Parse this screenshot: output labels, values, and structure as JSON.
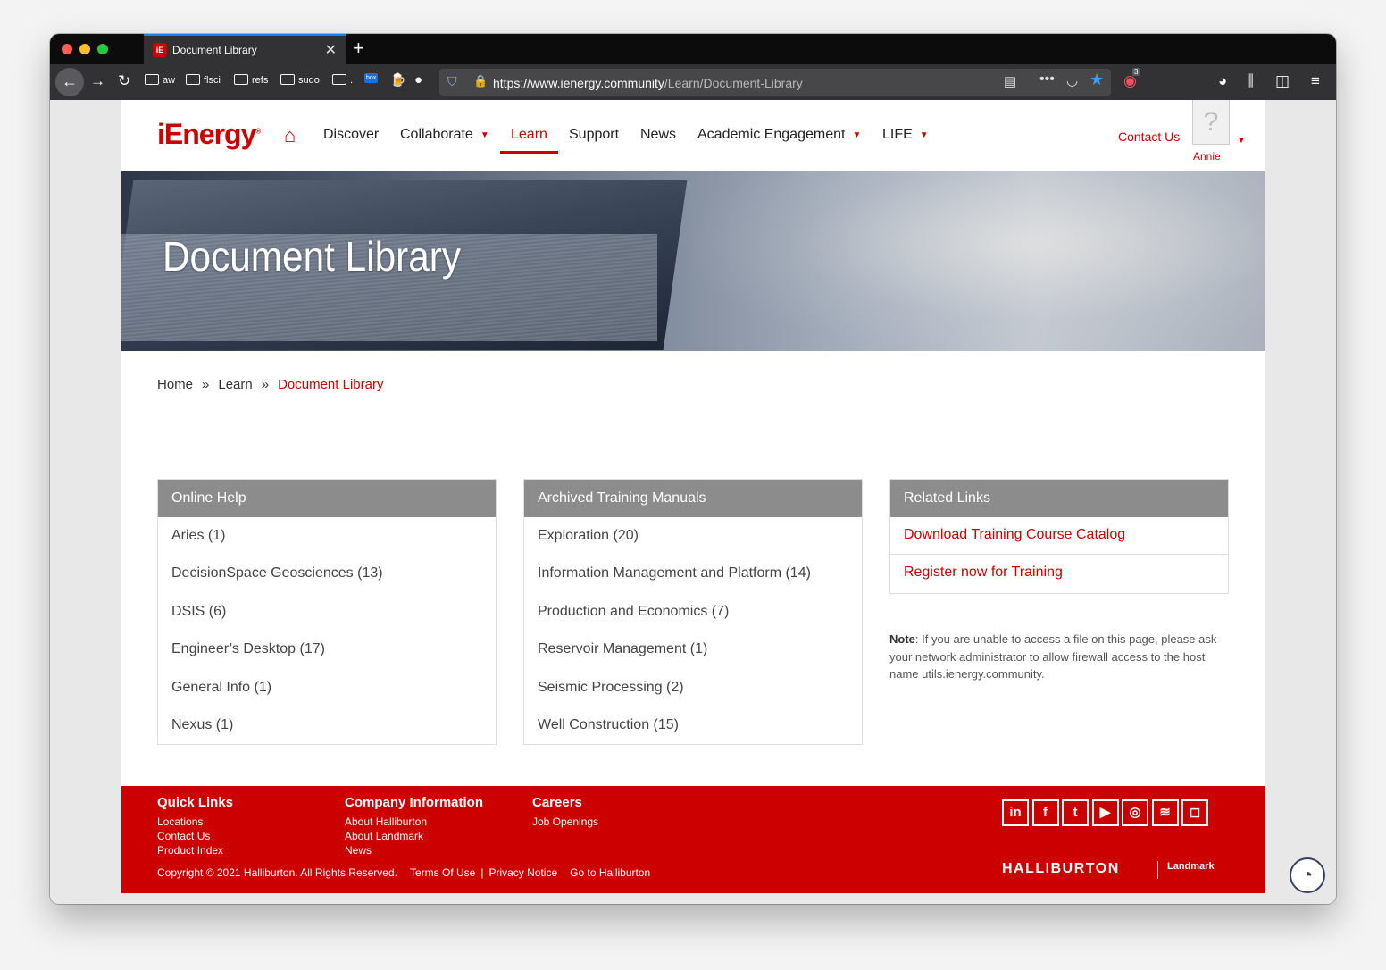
{
  "browser": {
    "tab_title": "Document Library",
    "tab_close": "✕",
    "new_tab": "+",
    "url_host": "https://www.ienergy.community",
    "url_path": "/Learn/Document-Library",
    "bookmarks": [
      "aw",
      "flsci",
      "refs",
      "sudo",
      "."
    ],
    "box_label": "box",
    "notification_count": "3"
  },
  "header": {
    "logo": "iEnergy",
    "logo_reg": "®",
    "menu": {
      "discover": "Discover",
      "collaborate": "Collaborate",
      "learn": "Learn",
      "support": "Support",
      "news": "News",
      "academic": "Academic Engagement",
      "life": "LIFE"
    },
    "contact": "Contact Us",
    "user_name": "Annie"
  },
  "banner": {
    "title": "Document Library"
  },
  "breadcrumb": {
    "home": "Home",
    "sep": "»",
    "learn": "Learn",
    "current": "Document Library"
  },
  "panels": {
    "online_help": {
      "title": "Online Help",
      "items": [
        "Aries (1)",
        "DecisionSpace Geosciences (13)",
        "DSIS (6)",
        "Engineer’s Desktop (17)",
        "General Info (1)",
        "Nexus (1)"
      ]
    },
    "archived": {
      "title": "Archived Training Manuals",
      "items": [
        "Exploration (20)",
        "Information Management and Platform (14)",
        "Production and Economics (7)",
        "Reservoir Management (1)",
        "Seismic Processing (2)",
        "Well Construction (15)"
      ]
    },
    "related": {
      "title": "Related Links",
      "items": [
        "Download Training Course Catalog",
        "Register now for Training"
      ]
    }
  },
  "note": {
    "label": "Note",
    "text": ": If you are unable to access a file on this page, please ask your network administrator to allow firewall access to the host name utils.ienergy.community."
  },
  "footer": {
    "quick_links": {
      "title": "Quick Links",
      "items": [
        "Locations",
        "Contact Us",
        "Product Index"
      ]
    },
    "company": {
      "title": "Company Information",
      "items": [
        "About Halliburton",
        "About Landmark",
        "News"
      ]
    },
    "careers": {
      "title": "Careers",
      "items": [
        "Job Openings"
      ]
    },
    "copyright": "Copyright © 2021 Halliburton. All Rights Reserved.",
    "terms": "Terms Of Use",
    "sep": "|",
    "privacy": "Privacy Notice",
    "goto": "Go to Halliburton",
    "brand": "HALLIBURTON",
    "brand2": "Landmark",
    "social": [
      "in",
      "f",
      "t",
      "▶",
      "◎",
      "≋",
      "◻"
    ]
  },
  "colors": {
    "brand_red": "#cc0000",
    "panel_header": "#8c8c8c",
    "browser_dark": "#323234"
  }
}
